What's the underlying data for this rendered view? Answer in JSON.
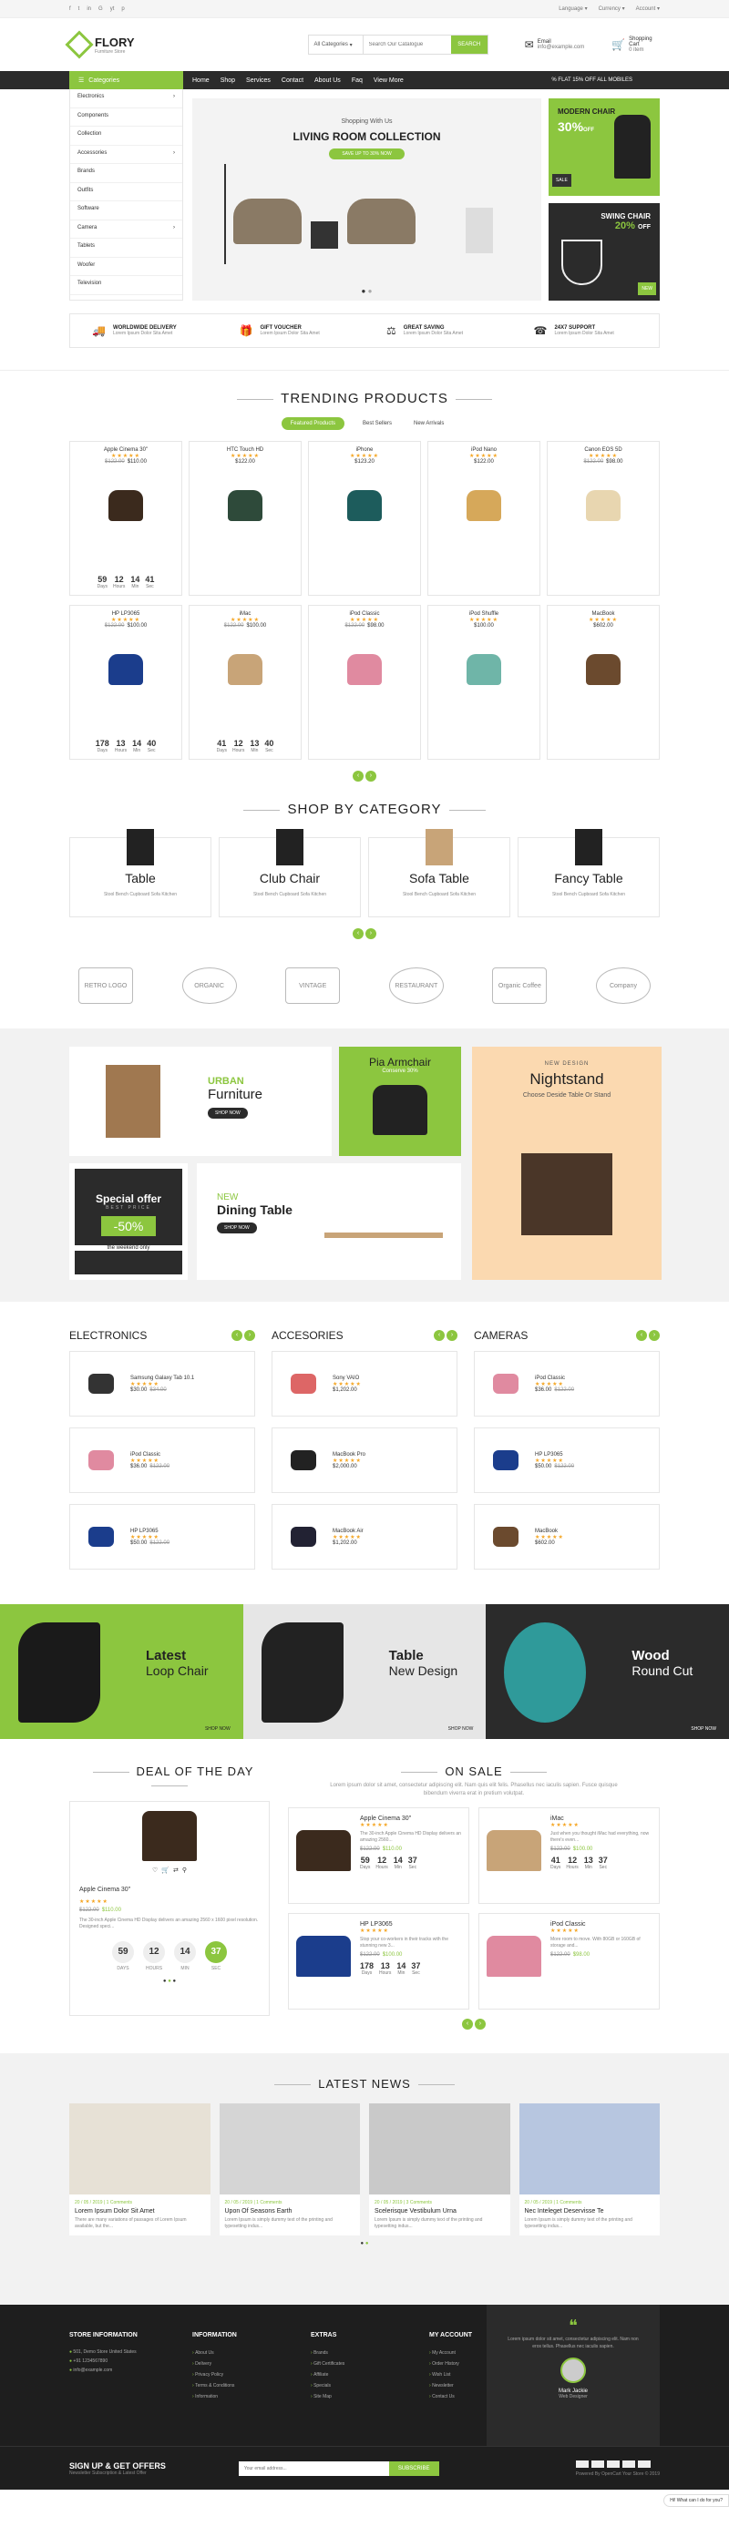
{
  "topbar": {
    "language": "Language",
    "currency": "Currency",
    "account": "Account",
    "social": [
      "f",
      "t",
      "in",
      "G",
      "yt",
      "p"
    ]
  },
  "header": {
    "brand": "FLORY",
    "tagline": "Furniture Store",
    "category_select": "All Categories",
    "search_placeholder": "Search Our Catalogue",
    "search_btn": "SEARCH",
    "email_label": "Email",
    "email": "info@example.com",
    "cart_label": "Shopping Cart",
    "cart_count": "0 item"
  },
  "nav": {
    "categories": "Categories",
    "links": [
      "Home",
      "Shop",
      "Services",
      "Contact",
      "About Us",
      "Faq",
      "View More"
    ],
    "offer": "FLAT 15% OFF ALL MOBILES"
  },
  "sidebar": [
    "Electronics",
    "Components",
    "Collection",
    "Accessories",
    "Brands",
    "Outfits",
    "Software",
    "Camera",
    "Tablets",
    "Woofer",
    "Television"
  ],
  "hero": {
    "small": "Shopping With Us",
    "title": "LIVING ROOM COLLECTION",
    "btn": "SAVE UP TO 30% NOW"
  },
  "side_banner1": {
    "title": "MODERN CHAIR",
    "pct": "30%",
    "off": "OFF",
    "badge": "SALE"
  },
  "side_banner2": {
    "title": "SWING CHAIR",
    "pct": "20%",
    "off": "OFF",
    "badge": "NEW"
  },
  "features": [
    {
      "title": "WORLDWIDE DELIVERY",
      "text": "Lorem Ipsum Dolor Sita Amet"
    },
    {
      "title": "GIFT VOUCHER",
      "text": "Lorem Ipsum Dolor Sita Amet"
    },
    {
      "title": "GREAT SAVING",
      "text": "Lorem Ipsum Dolor Sita Amet"
    },
    {
      "title": "24X7 SUPPORT",
      "text": "Lorem Ipsum Dolor Sita Amet"
    }
  ],
  "trending": {
    "title": "TRENDING PRODUCTS",
    "tabs": [
      "Featured Products",
      "Best Sellers",
      "New Arrivals"
    ],
    "row1": [
      {
        "name": "Apple Cinema 30\"",
        "old": "$122.00",
        "price": "$110.00",
        "timer": [
          "59",
          "12",
          "14",
          "41"
        ]
      },
      {
        "name": "HTC Touch HD",
        "old": "",
        "price": "$122.00"
      },
      {
        "name": "iPhone",
        "old": "",
        "price": "$123.20"
      },
      {
        "name": "iPod Nano",
        "old": "",
        "price": "$122.00"
      },
      {
        "name": "Canon EOS 5D",
        "old": "$122.00",
        "price": "$98.00"
      }
    ],
    "row2": [
      {
        "name": "HP LP3065",
        "old": "$122.00",
        "price": "$100.00",
        "timer": [
          "178",
          "13",
          "14",
          "40"
        ]
      },
      {
        "name": "iMac",
        "old": "$122.00",
        "price": "$100.00",
        "timer": [
          "41",
          "12",
          "13",
          "40"
        ]
      },
      {
        "name": "iPod Classic",
        "old": "$122.00",
        "price": "$98.00"
      },
      {
        "name": "iPod Shuffle",
        "old": "",
        "price": "$100.00"
      },
      {
        "name": "MacBook",
        "old": "",
        "price": "$602.00"
      }
    ],
    "timer_labels": [
      "Days",
      "Hours",
      "Min",
      "Sec"
    ]
  },
  "shop_cat": {
    "title": "SHOP BY CATEGORY",
    "items": [
      {
        "name": "Table",
        "sub": "Stool  Bench  Cupboard  Sofa  Kitchen"
      },
      {
        "name": "Club Chair",
        "sub": "Stool  Bench  Cupboard  Sofa  Kitchen"
      },
      {
        "name": "Sofa Table",
        "sub": "Stool  Bench  Cupboard  Sofa  Kitchen"
      },
      {
        "name": "Fancy Table",
        "sub": "Stool  Bench  Cupboard  Sofa  Kitchen"
      }
    ]
  },
  "brands": [
    "RETRO LOGO",
    "ORGANIC",
    "VINTAGE",
    "RESTAURANT",
    "Organic Coffee",
    "Company"
  ],
  "promo": {
    "urban1": "URBAN",
    "urban2": "Furniture",
    "shop": "SHOP NOW",
    "pia": "Pia Armchair",
    "pia_sub": "Conserve 30%",
    "night_small": "NEW DESIGN",
    "night": "Nightstand",
    "night_sub": "Choose Deside Table Or Stand",
    "special": "Special offer",
    "special_sub": "BEST PRICE",
    "special_pct": "-50%",
    "special_tag": "the weekend only",
    "dining_new": "NEW",
    "dining": "Dining Table"
  },
  "cols": [
    {
      "title": "ELECTRONICS",
      "items": [
        {
          "name": "Samsung Galaxy Tab 10.1",
          "price": "$30.00",
          "old": "$34.00"
        },
        {
          "name": "iPod Classic",
          "price": "$36.00",
          "old": "$122.00"
        },
        {
          "name": "HP LP3065",
          "price": "$50.00",
          "old": "$122.00"
        }
      ]
    },
    {
      "title": "ACCESORIES",
      "items": [
        {
          "name": "Sony VAIO",
          "price": "$1,202.00",
          "old": ""
        },
        {
          "name": "MacBook Pro",
          "price": "$2,000.00",
          "old": ""
        },
        {
          "name": "MacBook Air",
          "price": "$1,202.00",
          "old": ""
        }
      ]
    },
    {
      "title": "CAMERAS",
      "items": [
        {
          "name": "iPod Classic",
          "price": "$36.00",
          "old": "$122.00"
        },
        {
          "name": "HP LP3065",
          "price": "$50.00",
          "old": "$122.00"
        },
        {
          "name": "MacBook",
          "price": "$602.00",
          "old": ""
        }
      ]
    }
  ],
  "banners3": [
    {
      "a": "Latest",
      "b": "Loop Chair",
      "btn": "SHOP NOW"
    },
    {
      "a": "Table",
      "b": "New Design",
      "btn": "SHOP NOW"
    },
    {
      "a": "Wood",
      "b": "Round Cut",
      "btn": "SHOP NOW"
    }
  ],
  "deal": {
    "title": "DEAL OF THE DAY",
    "name": "Apple Cinema 30\"",
    "old": "$122.00",
    "price": "$110.00",
    "desc": "The 30-inch Apple Cinema HD Display delivers an amazing 2560 x 1600 pixel resolution. Designed speci...",
    "timer": [
      "59",
      "12",
      "14",
      "37"
    ],
    "labels": [
      "DAYS",
      "HOURS",
      "MIN",
      "SEC"
    ]
  },
  "onsale": {
    "title": "ON SALE",
    "desc": "Lorem ipsum dolor sit amet, consectetur adipiscing elit. Nam quis elit felis. Phasellus nec iaculis sapien. Fusce quisque bibendum viverra erat in pretium volutpat.",
    "items": [
      {
        "name": "Apple Cinema 30\"",
        "desc": "The 30-inch Apple Cinema HD Display delivers an amazing 2560...",
        "old": "$122.00",
        "price": "$110.00",
        "timer": [
          "59",
          "12",
          "14",
          "37"
        ]
      },
      {
        "name": "iMac",
        "desc": "Just when you thought iMac had everything, now there's even...",
        "old": "$122.00",
        "price": "$100.00",
        "timer": [
          "41",
          "12",
          "13",
          "37"
        ]
      },
      {
        "name": "HP LP3065",
        "desc": "Stop your co-workers in their tracks with the stunning new 3...",
        "old": "$122.00",
        "price": "$100.00",
        "timer": [
          "178",
          "13",
          "14",
          "37"
        ]
      },
      {
        "name": "iPod Classic",
        "desc": "More room to move. With 80GB or 160GB of storage and...",
        "old": "$122.00",
        "price": "$98.00"
      }
    ]
  },
  "news": {
    "title": "LATEST NEWS",
    "items": [
      {
        "meta": "20 / 05 / 2019  |  1 Comments",
        "title": "Lorem Ipsum Dolor Sit Amet",
        "text": "There are many variations of passages of Lorem Ipsum available, but the..."
      },
      {
        "meta": "20 / 05 / 2019  |  1 Comments",
        "title": "Upon Of Seasons Earth",
        "text": "Lorem Ipsum is simply dummy text of the printing and typesetting indus..."
      },
      {
        "meta": "20 / 05 / 2019  |  3 Comments",
        "title": "Scelerisque Vestibulum Urna",
        "text": "Lorem Ipsum is simply dummy text of the printing and typesetting indus..."
      },
      {
        "meta": "20 / 05 / 2019  |  1 Comments",
        "title": "Nec Inteleget Deservisse Te",
        "text": "Lorem Ipsum is simply dummy text of the printing and typesetting indus..."
      }
    ]
  },
  "footer": {
    "store_title": "STORE INFORMATION",
    "store": [
      "501, Demo Store United States",
      "+91 1234567890",
      "info@example.com"
    ],
    "info_title": "INFORMATION",
    "info": [
      "About Us",
      "Delivery",
      "Privacy Policy",
      "Terms & Conditions",
      "Information"
    ],
    "extras_title": "EXTRAS",
    "extras": [
      "Brands",
      "Gift Certificates",
      "Affiliate",
      "Specials",
      "Site Map"
    ],
    "acc_title": "MY ACCOUNT",
    "acc": [
      "My Account",
      "Order History",
      "Wish List",
      "Newsletter",
      "Contact Us"
    ],
    "quote": "Lorem ipsum dolor sit amet, consectetur adipiscing elit. Nam non eros tellus. Phasellus nec iaculis sapien.",
    "person": "Mark Jackie",
    "role": "Web Designer"
  },
  "signup": {
    "title": "SIGN UP & GET OFFERS",
    "sub": "Newsletter Subscription & Latest Offer",
    "placeholder": "Your email address...",
    "btn": "SUBSCRIBE",
    "powered": "Powered By OpenCart Your Store © 2019"
  },
  "chat": "Hi! What can I do for you?",
  "colors": {
    "accent": "#8cc63f",
    "dark": "#2b2b2b",
    "nightstand": "#fbd9b0"
  }
}
